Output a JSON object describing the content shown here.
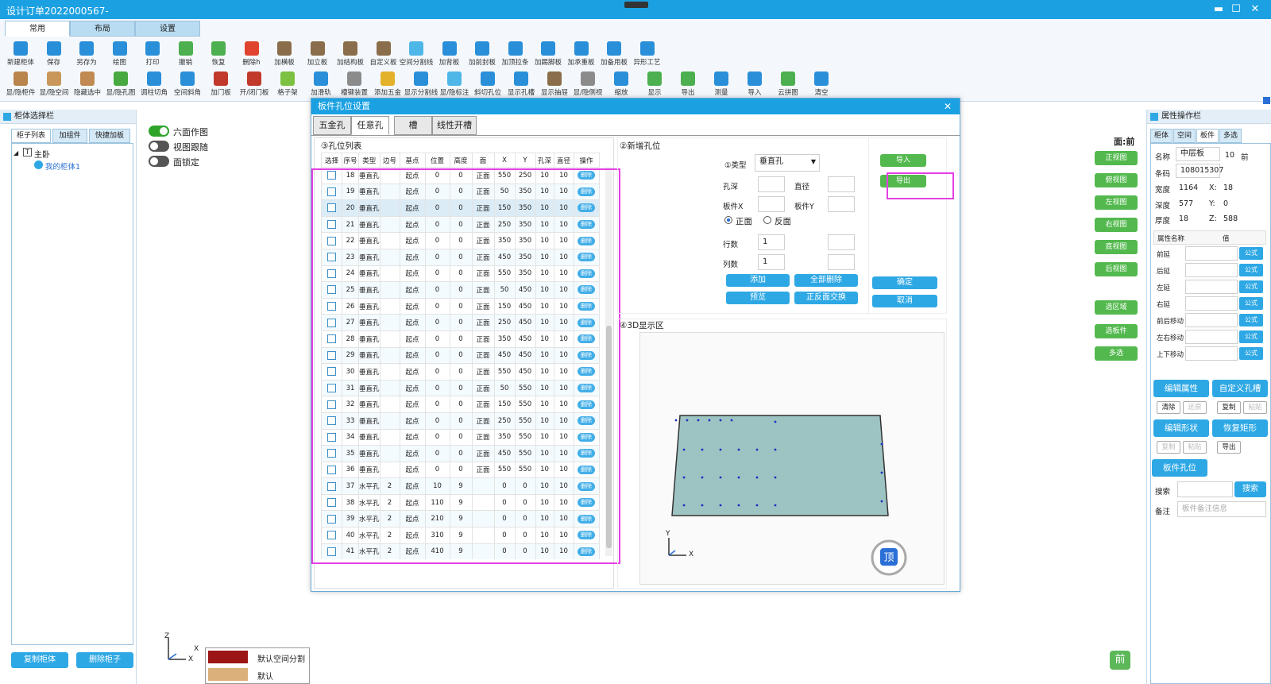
{
  "window": {
    "title": "设计订单2022000567-",
    "min": "▬",
    "max": "☐",
    "close": "✕"
  },
  "ribbon": {
    "tabs": [
      "常用",
      "布局",
      "设置"
    ],
    "row1": [
      "新建柜体",
      "保存",
      "另存为",
      "绘图",
      "打印",
      "撤销",
      "恢复",
      "删除h",
      "加横板",
      "加立板",
      "加结构板",
      "自定义板",
      "空间分割线",
      "加背板",
      "加前封板",
      "加顶拉条",
      "加踢脚板",
      "加承重板",
      "加备用板",
      "异形工艺"
    ],
    "row2": [
      "显/隐柜件",
      "显/隐空间",
      "隐藏选中",
      "显/隐孔图",
      "调柱切角",
      "空间斜角",
      "加门板",
      "开/闭门板",
      "格子架",
      "加滑轨",
      "槽键装置",
      "添加五金",
      "显示分割线",
      "显/隐标注",
      "斜切孔位",
      "显示孔槽",
      "显示抽屉",
      "显/隐侧视",
      "缩放",
      "显示",
      "导出",
      "测量",
      "导入",
      "云拼图",
      "清空"
    ],
    "row1_colors": [
      "#2a8fd9",
      "#2a8fd9",
      "#2a8fd9",
      "#2a8fd9",
      "#2a8fd9",
      "#4caf50",
      "#4caf50",
      "#e0442f",
      "#8a6d4b",
      "#8a6d4b",
      "#8a6d4b",
      "#8a6d4b",
      "#4fb6e8",
      "#2a8fd9",
      "#2a8fd9",
      "#2a8fd9",
      "#2a8fd9",
      "#2a8fd9",
      "#2a8fd9",
      "#2a8fd9"
    ],
    "row2_colors": [
      "#b9854c",
      "#c9975a",
      "#c08a52",
      "#47a93f",
      "#2a8fd9",
      "#2a8fd9",
      "#c0392b",
      "#c0392b",
      "#7cc142",
      "#2a8fd9",
      "#8b8b8b",
      "#e3b12a",
      "#2a8fd9",
      "#4fb6e8",
      "#2a8fd9",
      "#2a8fd9",
      "#8a6d4b",
      "#8b8b8b",
      "#2a8fd9",
      "#4caf50",
      "#4caf50",
      "#2a8fd9",
      "#2a8fd9",
      "#4caf50",
      "#2a8fd9"
    ]
  },
  "left_panel": {
    "title": "柜体选择栏",
    "tabs": [
      "柜子列表",
      "加组件",
      "快捷加板"
    ],
    "tree_root": "主卧",
    "tree_child": "我的柜体1",
    "copy_button": "复制柜体",
    "delete_button": "删除柜子"
  },
  "view_toggles": [
    {
      "label": "六面作图",
      "on": true
    },
    {
      "label": "视图跟随",
      "on": false
    },
    {
      "label": "面锁定",
      "on": false
    }
  ],
  "view_buttons": {
    "face_label": "面:前",
    "items": [
      "正视图",
      "俯视图",
      "左视图",
      "右视图",
      "底视图",
      "后视图",
      "选区域",
      "选板件",
      "多选"
    ],
    "front_badge": "前"
  },
  "materials": [
    {
      "name": "默认空间分割",
      "color": "#9c1616"
    },
    {
      "name": "默认",
      "color": "#dcb07a"
    }
  ],
  "dialog": {
    "title": "板件孔位设置",
    "close": "✕",
    "tabs": [
      "五金孔",
      "任意孔",
      "槽",
      "线性开槽"
    ],
    "list_title": "③孔位列表",
    "columns": [
      "选择",
      "序号",
      "类型",
      "边号",
      "基点",
      "位置",
      "高度",
      "面",
      "X",
      "Y",
      "孔深",
      "直径",
      "操作"
    ],
    "rows": [
      [
        "18",
        "垂直孔",
        "",
        "起点",
        "0",
        "0",
        "正面",
        "550",
        "250",
        "10",
        "10"
      ],
      [
        "19",
        "垂直孔",
        "",
        "起点",
        "0",
        "0",
        "正面",
        "50",
        "350",
        "10",
        "10"
      ],
      [
        "20",
        "垂直孔",
        "",
        "起点",
        "0",
        "0",
        "正面",
        "150",
        "350",
        "10",
        "10"
      ],
      [
        "21",
        "垂直孔",
        "",
        "起点",
        "0",
        "0",
        "正面",
        "250",
        "350",
        "10",
        "10"
      ],
      [
        "22",
        "垂直孔",
        "",
        "起点",
        "0",
        "0",
        "正面",
        "350",
        "350",
        "10",
        "10"
      ],
      [
        "23",
        "垂直孔",
        "",
        "起点",
        "0",
        "0",
        "正面",
        "450",
        "350",
        "10",
        "10"
      ],
      [
        "24",
        "垂直孔",
        "",
        "起点",
        "0",
        "0",
        "正面",
        "550",
        "350",
        "10",
        "10"
      ],
      [
        "25",
        "垂直孔",
        "",
        "起点",
        "0",
        "0",
        "正面",
        "50",
        "450",
        "10",
        "10"
      ],
      [
        "26",
        "垂直孔",
        "",
        "起点",
        "0",
        "0",
        "正面",
        "150",
        "450",
        "10",
        "10"
      ],
      [
        "27",
        "垂直孔",
        "",
        "起点",
        "0",
        "0",
        "正面",
        "250",
        "450",
        "10",
        "10"
      ],
      [
        "28",
        "垂直孔",
        "",
        "起点",
        "0",
        "0",
        "正面",
        "350",
        "450",
        "10",
        "10"
      ],
      [
        "29",
        "垂直孔",
        "",
        "起点",
        "0",
        "0",
        "正面",
        "450",
        "450",
        "10",
        "10"
      ],
      [
        "30",
        "垂直孔",
        "",
        "起点",
        "0",
        "0",
        "正面",
        "550",
        "450",
        "10",
        "10"
      ],
      [
        "31",
        "垂直孔",
        "",
        "起点",
        "0",
        "0",
        "正面",
        "50",
        "550",
        "10",
        "10"
      ],
      [
        "32",
        "垂直孔",
        "",
        "起点",
        "0",
        "0",
        "正面",
        "150",
        "550",
        "10",
        "10"
      ],
      [
        "33",
        "垂直孔",
        "",
        "起点",
        "0",
        "0",
        "正面",
        "250",
        "550",
        "10",
        "10"
      ],
      [
        "34",
        "垂直孔",
        "",
        "起点",
        "0",
        "0",
        "正面",
        "350",
        "550",
        "10",
        "10"
      ],
      [
        "35",
        "垂直孔",
        "",
        "起点",
        "0",
        "0",
        "正面",
        "450",
        "550",
        "10",
        "10"
      ],
      [
        "36",
        "垂直孔",
        "",
        "起点",
        "0",
        "0",
        "正面",
        "550",
        "550",
        "10",
        "10"
      ],
      [
        "37",
        "水平孔",
        "2",
        "起点",
        "10",
        "9",
        "",
        "0",
        "0",
        "10",
        "10"
      ],
      [
        "38",
        "水平孔",
        "2",
        "起点",
        "110",
        "9",
        "",
        "0",
        "0",
        "10",
        "10"
      ],
      [
        "39",
        "水平孔",
        "2",
        "起点",
        "210",
        "9",
        "",
        "0",
        "0",
        "10",
        "10"
      ],
      [
        "40",
        "水平孔",
        "2",
        "起点",
        "310",
        "9",
        "",
        "0",
        "0",
        "10",
        "10"
      ],
      [
        "41",
        "水平孔",
        "2",
        "起点",
        "410",
        "9",
        "",
        "0",
        "0",
        "10",
        "10"
      ]
    ],
    "delete_label": "删除",
    "new_hole": {
      "title": "②新增孔位",
      "type_label": "①类型",
      "type_value": "垂直孔",
      "depth_label": "孔深",
      "diameter_label": "直径",
      "x_label": "板件X",
      "y_label": "板件Y",
      "front_label": "正面",
      "back_label": "反面",
      "rows_label": "行数",
      "rows_value": "1",
      "cols_label": "列数",
      "cols_value": "1",
      "add": "添加",
      "delete_all": "全部删除",
      "preview": "预览",
      "swap": "正反面交换",
      "import": "导入",
      "export": "导出",
      "ok": "确定",
      "cancel": "取消"
    },
    "view3d": {
      "title": "④3D显示区",
      "axis_y": "Y",
      "axis_x": "X",
      "top_badge": "顶"
    }
  },
  "right_panel": {
    "title": "属性操作栏",
    "tabs": [
      "柜体",
      "空间",
      "板件",
      "多选"
    ],
    "name_label": "名称",
    "name_value": "中层板",
    "name_num": "10",
    "name_face": "前",
    "code_label": "条码",
    "code_value": "108015307",
    "width_label": "宽度",
    "width_value": "1164",
    "x_label": "X:",
    "x_value": "18",
    "depth_label": "深度",
    "depth_value": "577",
    "y_label": "Y:",
    "y_value": "0",
    "thick_label": "厚度",
    "thick_value": "18",
    "z_label": "Z:",
    "z_value": "588",
    "attr_header": [
      "属性名称",
      "值"
    ],
    "attrs": [
      "前延",
      "后延",
      "左延",
      "右延",
      "前后移动",
      "左右移动",
      "上下移动"
    ],
    "formula": "公式",
    "edit_attr": "编辑属性",
    "custom_slot": "自定义孔槽",
    "clear": "清除",
    "restore": "还原",
    "copy": "复制",
    "paste": "粘贴",
    "edit_shape": "编辑形状",
    "restore_rect": "恢复矩形",
    "copy2": "复制",
    "paste2": "粘贴",
    "export": "导出",
    "hole_pos": "板件孔位",
    "search_label": "搜索",
    "search_button": "搜索",
    "note_label": "备注",
    "note_placeholder": "板件备注信息"
  },
  "bottom_axis": {
    "z": "Z",
    "x": "X",
    "x2": "X"
  }
}
